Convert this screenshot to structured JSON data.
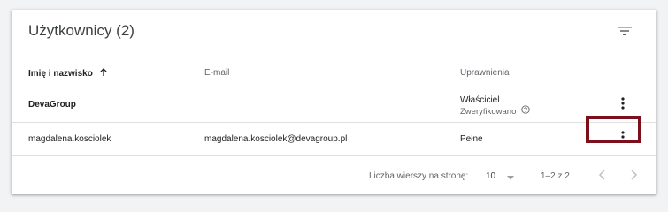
{
  "card": {
    "title": "Użytkownicy (2)"
  },
  "icons": {
    "filter": "filter-icon",
    "sort": "arrow-up-icon",
    "more": "more-vert-icon",
    "help": "help-icon",
    "caret": "caret-down-icon",
    "prev": "chevron-left-icon",
    "next": "chevron-right-icon"
  },
  "table": {
    "columns": {
      "name": "Imię i nazwisko",
      "email": "E-mail",
      "permissions": "Uprawnienia"
    },
    "rows": [
      {
        "name": "DevaGroup",
        "email": "",
        "permission": "Właściciel",
        "sub": "Zweryfikowano"
      },
      {
        "name": "magdalena.kosciolek",
        "email": "magdalena.kosciolek@devagroup.pl",
        "permission": "Pełne"
      }
    ]
  },
  "footer": {
    "rows_per_page_label": "Liczba wierszy na stronę:",
    "rows_per_page_value": "10",
    "range": "1–2 z 2"
  },
  "colors": {
    "highlight": "#7b0f1c",
    "background": "#f1f3f4"
  }
}
